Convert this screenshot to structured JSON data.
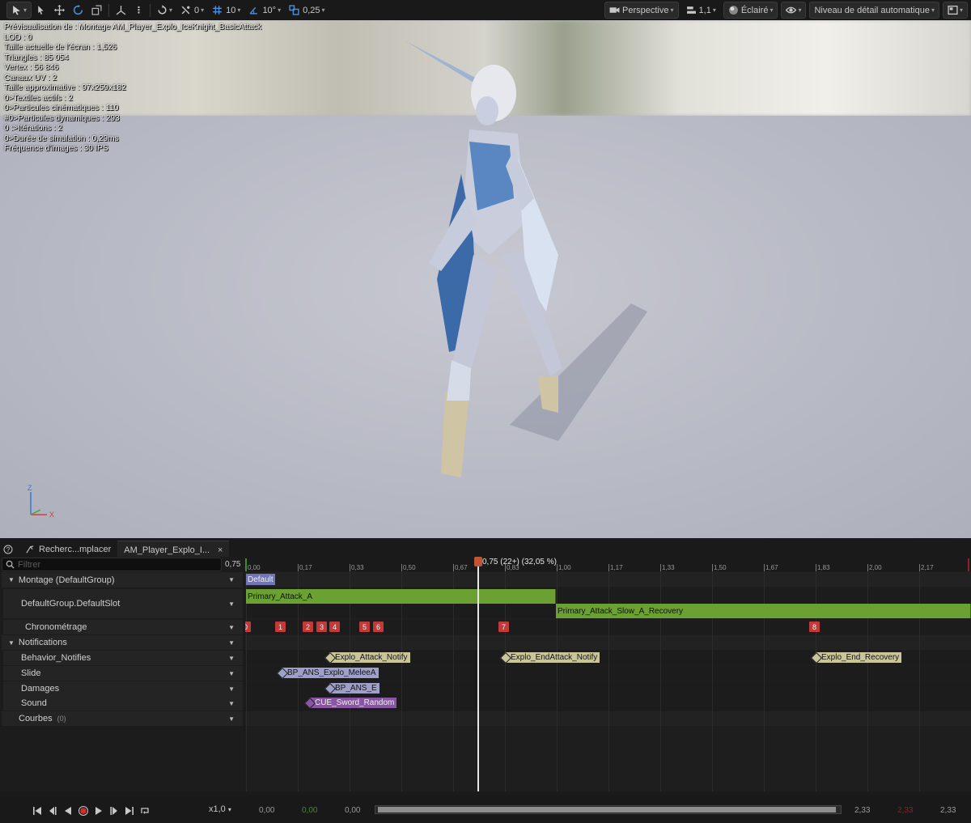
{
  "toolbar": {
    "snap_translate": "0",
    "grid_translate": "10",
    "rot_snap": "10°",
    "scale_snap": "0,25",
    "view_mode": "Perspective",
    "camera_speed": "1,1",
    "lighting": "Éclairé",
    "lod": "Niveau de détail automatique"
  },
  "stats": [
    "Prévisualisation de : Montage AM_Player_Explo_IceKnight_BasicAttack",
    "LOD : 0",
    "Taille actuelle de l'écran : 1,526",
    "Triangles : 85 054",
    "Vertex : 56 846",
    "Canaux UV : 2",
    "Taille approximative : 97x259x182",
    "0>Textiles actifs : 2",
    "0>Particules cinématiques : 110",
    "#0>Particules dynamiques : 293",
    "0 :>Itérations : 2",
    "0>Durée de simulation : 0,29ms",
    "Fréquence d'images : 30 IPS"
  ],
  "gizmo": {
    "z": "Z",
    "x": "X"
  },
  "tabs": [
    {
      "label": "Recherc...mplacer"
    },
    {
      "label": "AM_Player_Explo_I...",
      "close": "×"
    }
  ],
  "filter": {
    "placeholder": "Filtrer",
    "current_time": "0,75"
  },
  "tracks": {
    "montage": "Montage (DefaultGroup)",
    "slot": "DefaultGroup.DefaultSlot",
    "timing": "Chronométrage",
    "notifications": "Notifications",
    "behavior": "Behavior_Notifies",
    "slide": "Slide",
    "damages": "Damages",
    "sound": "Sound",
    "curves": "Courbes",
    "curves_count": "(0)"
  },
  "ruler": {
    "ticks": [
      "0,00",
      "0,17",
      "0,33",
      "0,50",
      "0,67",
      "0,83",
      "1,00",
      "1,17",
      "1,33",
      "1,50",
      "1,67",
      "1,83",
      "2,00",
      "2,17"
    ],
    "playhead_label": "0,75 (22+) (32,05 %)"
  },
  "timeline": {
    "section": "Default",
    "segments": [
      "Primary_Attack_A",
      "Primary_Attack_Slow_A_Recovery"
    ],
    "markers": [
      "0",
      "1",
      "2",
      "3",
      "4",
      "5",
      "6",
      "7",
      "8"
    ],
    "notifies": {
      "behavior": [
        "Explo_Attack_Notify",
        "Explo_EndAttack_Notify",
        "Explo_End_Recovery"
      ],
      "slide": "BP_ANS_Explo_MeleeA",
      "damages": "BP_ANS_E",
      "sound": "CUE_Sword_Random"
    }
  },
  "transport": {
    "speed": "x1,0",
    "t_start": "0,00",
    "t_green": "0,00",
    "t_cur": "0,00",
    "t_end1": "2,33",
    "t_red": "2,33",
    "t_end2": "2,33"
  },
  "colors": {
    "segment_green": "#6aa132",
    "marker_red": "#c03a3a",
    "notify_yellow": "#c9c598",
    "notify_blue": "#9fa0c9",
    "notify_purple": "#8a55a4",
    "playhead_head": "#c35433"
  }
}
